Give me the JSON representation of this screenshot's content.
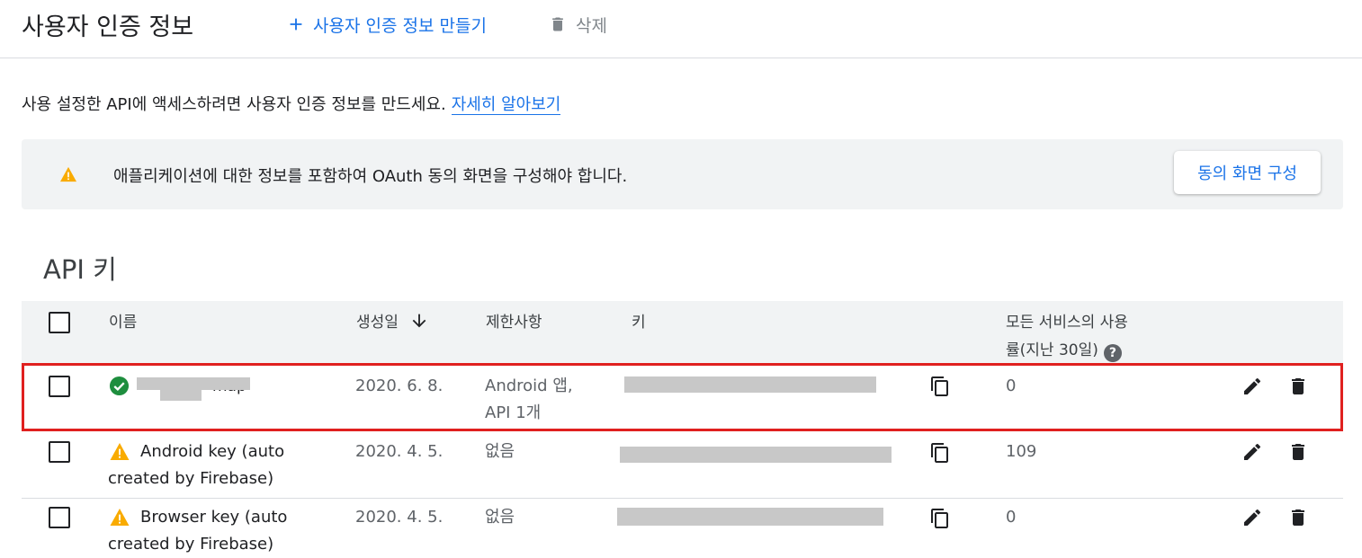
{
  "header": {
    "title": "사용자 인증 정보",
    "create_label": "사용자 인증 정보 만들기",
    "delete_label": "삭제"
  },
  "intro": {
    "text": "사용 설정한 API에 액세스하려면 사용자 인증 정보를 만드세요.",
    "link": "자세히 알아보기"
  },
  "notice": {
    "message": "애플리케이션에 대한 정보를 포함하여 OAuth 동의 화면을 구성해야 합니다.",
    "button": "동의 화면 구성"
  },
  "section": {
    "title": "API 키"
  },
  "table": {
    "columns": {
      "name": "이름",
      "created": "생성일",
      "restrictions": "제한사항",
      "key": "키",
      "usage_line1": "모든 서비스의 사용",
      "usage_line2": "률(지난 30일)"
    },
    "rows": [
      {
        "status": "ok",
        "name": "",
        "name_visible_fragment": "map",
        "created": "2020. 6. 8.",
        "restrictions_line1": "Android 앱,",
        "restrictions_line2": "API 1개",
        "usage": "0"
      },
      {
        "status": "warning",
        "name_line1": "Android key (auto",
        "name_line2": "created by Firebase)",
        "created": "2020. 4. 5.",
        "restrictions_line1": "없음",
        "usage": "109"
      },
      {
        "status": "warning",
        "name_line1": "Browser key (auto",
        "name_line2": "created by Firebase)",
        "created": "2020. 4. 5.",
        "restrictions_line1": "없음",
        "usage": "0"
      }
    ]
  },
  "colors": {
    "accent": "#1a73e8",
    "warning": "#f9ab00",
    "success": "#1e8e3e",
    "highlight": "#e0201f"
  }
}
